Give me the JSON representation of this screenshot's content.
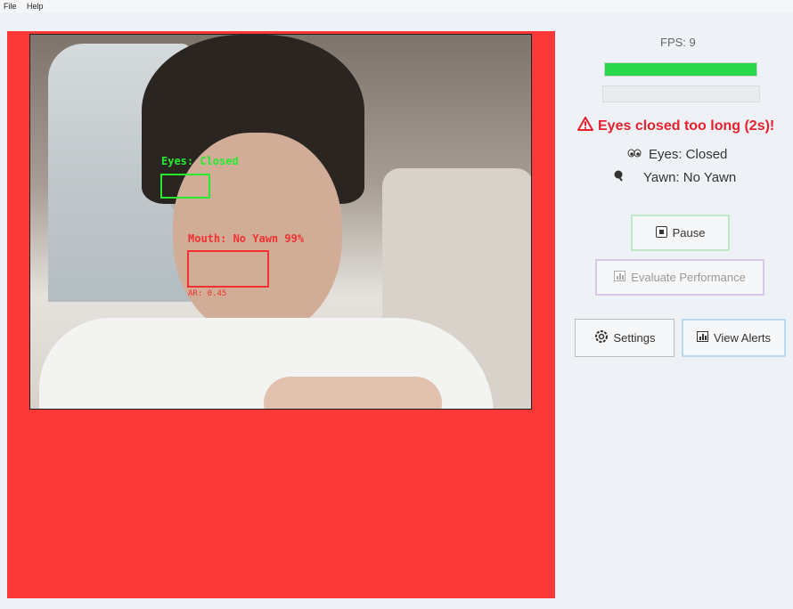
{
  "menu": {
    "file": "File",
    "help": "Help"
  },
  "detections": {
    "eyes_label": "Eyes: Closed",
    "mouth_label": "Mouth: No Yawn 99%",
    "ar_label": "AR: 0.45"
  },
  "sidebar": {
    "fps": "FPS: 9",
    "fps_bar_fill": 1.0,
    "alert_text": "Eyes closed too long (2s)!",
    "eyes_status": "Eyes: Closed",
    "yawn_status": "Yawn: No Yawn",
    "pause_label": "Pause",
    "evaluate_label": "Evaluate Performance",
    "settings_label": "Settings",
    "view_alerts_label": "View Alerts"
  },
  "colors": {
    "alert_red": "#fb3838",
    "detect_green": "#27ea2f",
    "fps_green": "#28d84a",
    "alert_text": "#e8202e"
  },
  "icons": [
    "warning-icon",
    "eyes-icon",
    "mouth-icon",
    "pause-icon",
    "chart-icon",
    "gear-icon",
    "bell-icon"
  ]
}
